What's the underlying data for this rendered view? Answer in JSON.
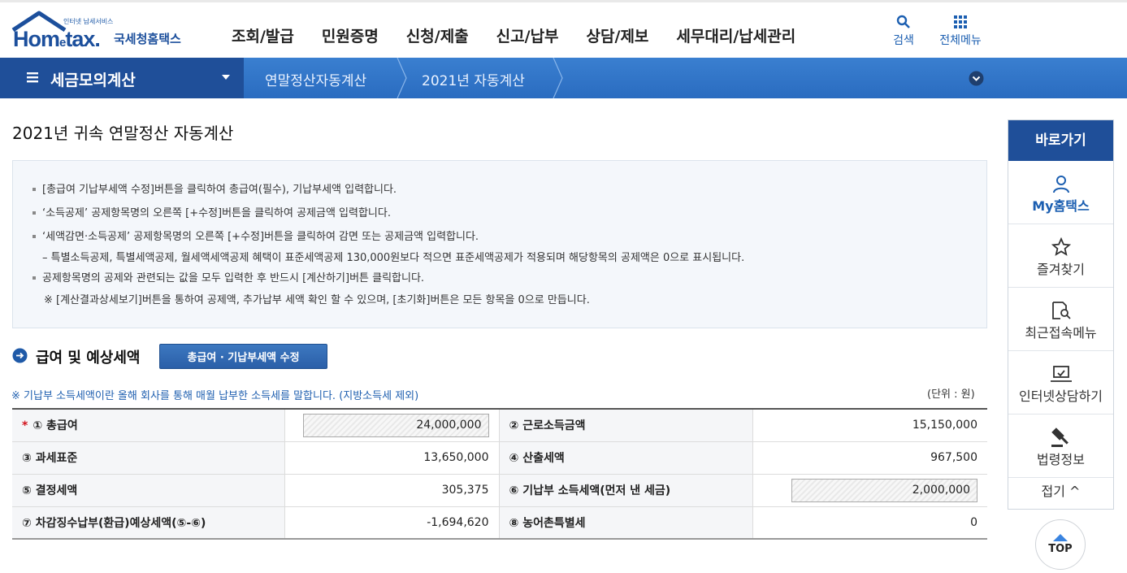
{
  "header": {
    "logo_small": "인터넷 납세서비스",
    "logo_brand_a": "Hom",
    "logo_brand_e": "e",
    "logo_brand_b": "tax.",
    "logo_kor": "국세청홈택스",
    "nav": [
      "조회/발급",
      "민원증명",
      "신청/제출",
      "신고/납부",
      "상담/제보",
      "세무대리/납세관리"
    ],
    "search_label": "검색",
    "allmenu_label": "전체메뉴"
  },
  "bar": {
    "menu_title": "세금모의계산",
    "crumb1": "연말정산자동계산",
    "crumb2": "2021년 자동계산"
  },
  "page_title": "2021년 귀속 연말정산 자동계산",
  "notice": {
    "l1": "[총급여 기납부세액 수정]버튼을 클릭하여 총급여(필수), 기납부세액 입력합니다.",
    "l2": "‘소득공제’ 공제항목명의 오른쪽 [+수정]버튼을 클릭하여 공제금액 입력합니다.",
    "l3": "‘세액감면·소득공제’ 공제항목명의 오른쪽 [+수정]버튼을 클릭하여 감면 또는 공제금액 입력합니다.",
    "l4": "– 특별소득공제, 특별세액공제, 월세액세액공제 혜택이 표준세액공제 130,000원보다 적으면 표준세액공제가 적용되며 해당항목의 공제액은 0으로 표시됩니다.",
    "l5": "공제항목명의 공제와 관련되는 값을 모두 입력한 후 반드시 [계산하기]버튼 클릭합니다.",
    "l6": "※ [계산결과상세보기]버튼을 통하여 공제액, 추가납부 세액 확인 할 수 있으며, [초기화]버튼은 모든 항목을 0으로 만듭니다."
  },
  "section": {
    "title": "급여 및 예상세액",
    "edit_button": "총급여 · 기납부세액 수정",
    "note": "※ 기납부 소득세액이란 올해 회사를 통해 매월 납부한 소득세를 말합니다. (지방소득세 제외)",
    "unit": "(단위 : 원)"
  },
  "table": {
    "required_mark": "*",
    "r1": {
      "l1": "① 총급여",
      "v1": "24,000,000",
      "l2": "② 근로소득금액",
      "v2": "15,150,000"
    },
    "r2": {
      "l1": "③ 과세표준",
      "v1": "13,650,000",
      "l2": "④ 산출세액",
      "v2": "967,500"
    },
    "r3": {
      "l1": "⑤ 결정세액",
      "v1": "305,375",
      "l2": "⑥ 기납부 소득세액(먼저 낸 세금)",
      "v2": "2,000,000"
    },
    "r4": {
      "l1": "⑦ 차감징수납부(환급)예상세액(⑤-⑥)",
      "v1": "-1,694,620",
      "l2": "⑧ 농어촌특별세",
      "v2": "0"
    }
  },
  "quick": {
    "head": "바로가기",
    "my": "My홈택스",
    "fav": "즐겨찾기",
    "recent": "최근접속메뉴",
    "consult": "인터넷상담하기",
    "law": "법령정보",
    "fold": "접기 ^"
  },
  "top_label": "TOP"
}
